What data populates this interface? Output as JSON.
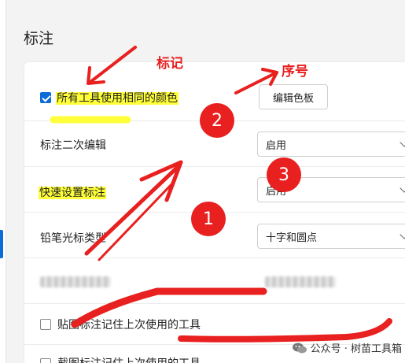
{
  "section": {
    "title": "标注"
  },
  "settings": {
    "same_color": {
      "label": "所有工具使用相同的颜色",
      "checked": true,
      "button_label": "编辑色板"
    },
    "secondary_edit": {
      "label": "标注二次编辑",
      "value": "启用"
    },
    "quick_setup": {
      "label": "快速设置标注",
      "value": "启用"
    },
    "pencil_cursor": {
      "label": "铅笔光标类型",
      "value": "十字和圆点"
    },
    "pin_remember": {
      "label": "贴图标注记住上次使用的工具",
      "checked": false
    },
    "capture_remember": {
      "label": "截图标注记住上次使用的工具",
      "checked": false
    }
  },
  "annotations": {
    "mark_label": "标记",
    "serial_label": "序号",
    "badges": [
      "1",
      "2",
      "3"
    ],
    "color": "#e8201f",
    "highlight_color": "#ffff3a"
  },
  "watermark": {
    "text": "公众号 · 树苗工具箱",
    "icon": "wechat-icon"
  },
  "colors": {
    "accent": "#0a6cd6"
  }
}
